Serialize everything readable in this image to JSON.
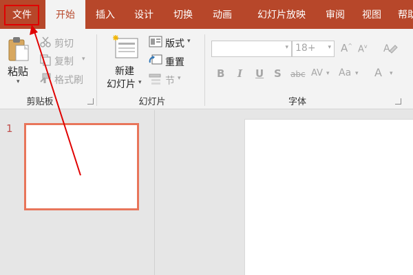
{
  "tabs": [
    "文件",
    "开始",
    "插入",
    "设计",
    "切换",
    "动画",
    "幻灯片放映",
    "审阅",
    "视图",
    "帮助"
  ],
  "clipboard": {
    "paste": "粘贴",
    "cut": "剪切",
    "copy": "复制",
    "format_painter": "格式刷",
    "group_label": "剪贴板"
  },
  "slides_group": {
    "new_slide_line1": "新建",
    "new_slide_line2": "幻灯片",
    "layout": "版式",
    "reset": "重置",
    "section": "节",
    "group_label": "幻灯片"
  },
  "font_group": {
    "font_name": "",
    "font_size": "18+",
    "group_label": "字体",
    "bold": "B",
    "italic": "I",
    "underline": "U",
    "shadow": "S",
    "strikethrough": "abc",
    "spacing": "AV",
    "change_case": "Aa",
    "font_color": "A"
  },
  "slide_panel": {
    "slide_number": "1"
  },
  "colors": {
    "accent": "#b7472a",
    "highlight": "#e00000",
    "thumb_border": "#e8755a"
  }
}
